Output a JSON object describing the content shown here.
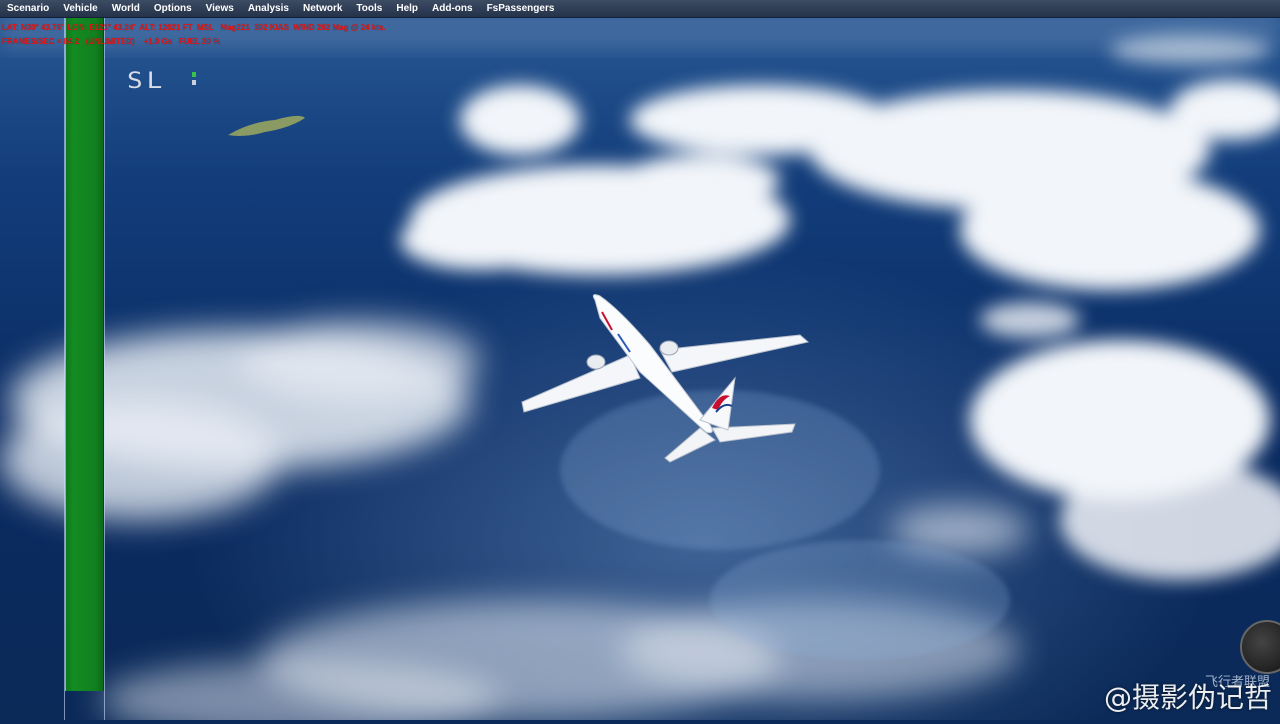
{
  "menu": {
    "items": [
      {
        "label": "Scenario",
        "name": "menu-scenario"
      },
      {
        "label": "Vehicle",
        "name": "menu-vehicle"
      },
      {
        "label": "World",
        "name": "menu-world"
      },
      {
        "label": "Options",
        "name": "menu-options"
      },
      {
        "label": "Views",
        "name": "menu-views"
      },
      {
        "label": "Analysis",
        "name": "menu-analysis"
      },
      {
        "label": "Network",
        "name": "menu-network"
      },
      {
        "label": "Tools",
        "name": "menu-tools"
      },
      {
        "label": "Help",
        "name": "menu-help"
      },
      {
        "label": "Add-ons",
        "name": "menu-addons"
      },
      {
        "label": "FsPassengers",
        "name": "menu-fspassengers"
      }
    ]
  },
  "hud": {
    "line1": "LAT: N30° 43.76'  LON: E121° 43.24'  ALT: 12021 FT  MSL   Mag221  302 KIAS  WIND 262 Mag @ 24 kts.",
    "line2": "FRAMES/SEC = 84.2   (UNLIMITED)    +1.0 Gs   FUEL 20 %"
  },
  "overlay": {
    "sl_label": "SL"
  },
  "watermark": {
    "text": "@摄影伪记哲",
    "logo_text": "飞行者联盟"
  },
  "colors": {
    "hud_text": "#e01818",
    "menu_bg": "#2f3d55",
    "bar_green": "#12801f",
    "ocean": "#0b2a5a"
  },
  "scene_objects": {
    "aircraft": "airliner-icon",
    "airline_tail_logo": "china-eastern-logo-icon"
  }
}
